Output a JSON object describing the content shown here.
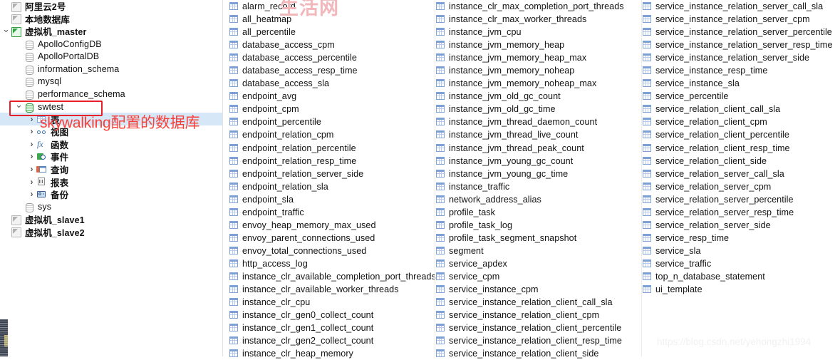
{
  "tree": {
    "items": [
      {
        "label": "阿里云2号",
        "icon": "connection-icon",
        "indent": 0,
        "twisty": "none",
        "state": "offline",
        "type": "connection"
      },
      {
        "label": "本地数据库",
        "icon": "connection-icon",
        "indent": 0,
        "twisty": "none",
        "state": "offline",
        "type": "connection"
      },
      {
        "label": "虚拟机_master",
        "icon": "connection-icon",
        "indent": 0,
        "twisty": "open",
        "state": "online",
        "type": "connection"
      },
      {
        "label": "ApolloConfigDB",
        "icon": "database-icon",
        "indent": 1,
        "twisty": "none",
        "state": "closed",
        "type": "database"
      },
      {
        "label": "ApolloPortalDB",
        "icon": "database-icon",
        "indent": 1,
        "twisty": "none",
        "state": "closed",
        "type": "database"
      },
      {
        "label": "information_schema",
        "icon": "database-icon",
        "indent": 1,
        "twisty": "none",
        "state": "closed",
        "type": "database"
      },
      {
        "label": "mysql",
        "icon": "database-icon",
        "indent": 1,
        "twisty": "none",
        "state": "closed",
        "type": "database"
      },
      {
        "label": "performance_schema",
        "icon": "database-icon",
        "indent": 1,
        "twisty": "none",
        "state": "closed",
        "type": "database"
      },
      {
        "label": "swtest",
        "icon": "database-icon",
        "indent": 1,
        "twisty": "open",
        "state": "open",
        "type": "database"
      },
      {
        "label": "表",
        "icon": "tables-folder-icon",
        "indent": 2,
        "twisty": "closed",
        "state": "selected",
        "type": "tables"
      },
      {
        "label": "视图",
        "icon": "views-icon",
        "indent": 2,
        "twisty": "closed",
        "state": "",
        "type": "views"
      },
      {
        "label": "函数",
        "icon": "functions-icon",
        "indent": 2,
        "twisty": "closed",
        "state": "",
        "type": "functions"
      },
      {
        "label": "事件",
        "icon": "events-icon",
        "indent": 2,
        "twisty": "closed",
        "state": "",
        "type": "events"
      },
      {
        "label": "查询",
        "icon": "query-icon",
        "indent": 2,
        "twisty": "closed",
        "state": "",
        "type": "query"
      },
      {
        "label": "报表",
        "icon": "report-icon",
        "indent": 2,
        "twisty": "closed",
        "state": "",
        "type": "report"
      },
      {
        "label": "备份",
        "icon": "backup-icon",
        "indent": 2,
        "twisty": "closed",
        "state": "",
        "type": "backup"
      },
      {
        "label": "sys",
        "icon": "database-icon",
        "indent": 1,
        "twisty": "none",
        "state": "closed",
        "type": "database"
      },
      {
        "label": "虚拟机_slave1",
        "icon": "connection-icon",
        "indent": 0,
        "twisty": "none",
        "state": "offline",
        "type": "connection"
      },
      {
        "label": "虚拟机_slave2",
        "icon": "connection-icon",
        "indent": 0,
        "twisty": "none",
        "state": "offline",
        "type": "connection"
      }
    ]
  },
  "annotation": {
    "note_text": "skywalking配置的数据库",
    "note_color": "#f8403a",
    "box_color": "#e8202a",
    "target_label": "swtest"
  },
  "selection": {
    "selected_label": "表",
    "highlight_color": "#d6e8f7"
  },
  "watermarks": {
    "top": "生活网",
    "bottom": "https://blog.csdn.net/yehongzhi1994"
  },
  "tables": {
    "icon": "table-grid-icon",
    "columns": [
      [
        "alarm_record",
        "all_heatmap",
        "all_percentile",
        "database_access_cpm",
        "database_access_percentile",
        "database_access_resp_time",
        "database_access_sla",
        "endpoint_avg",
        "endpoint_cpm",
        "endpoint_percentile",
        "endpoint_relation_cpm",
        "endpoint_relation_percentile",
        "endpoint_relation_resp_time",
        "endpoint_relation_server_side",
        "endpoint_relation_sla",
        "endpoint_sla",
        "endpoint_traffic",
        "envoy_heap_memory_max_used",
        "envoy_parent_connections_used",
        "envoy_total_connections_used",
        "http_access_log",
        "instance_clr_available_completion_port_threads",
        "instance_clr_available_worker_threads",
        "instance_clr_cpu",
        "instance_clr_gen0_collect_count",
        "instance_clr_gen1_collect_count",
        "instance_clr_gen2_collect_count",
        "instance_clr_heap_memory"
      ],
      [
        "instance_clr_max_completion_port_threads",
        "instance_clr_max_worker_threads",
        "instance_jvm_cpu",
        "instance_jvm_memory_heap",
        "instance_jvm_memory_heap_max",
        "instance_jvm_memory_noheap",
        "instance_jvm_memory_noheap_max",
        "instance_jvm_old_gc_count",
        "instance_jvm_old_gc_time",
        "instance_jvm_thread_daemon_count",
        "instance_jvm_thread_live_count",
        "instance_jvm_thread_peak_count",
        "instance_jvm_young_gc_count",
        "instance_jvm_young_gc_time",
        "instance_traffic",
        "network_address_alias",
        "profile_task",
        "profile_task_log",
        "profile_task_segment_snapshot",
        "segment",
        "service_apdex",
        "service_cpm",
        "service_instance_cpm",
        "service_instance_relation_client_call_sla",
        "service_instance_relation_client_cpm",
        "service_instance_relation_client_percentile",
        "service_instance_relation_client_resp_time",
        "service_instance_relation_client_side"
      ],
      [
        "service_instance_relation_server_call_sla",
        "service_instance_relation_server_cpm",
        "service_instance_relation_server_percentile",
        "service_instance_relation_server_resp_time",
        "service_instance_relation_server_side",
        "service_instance_resp_time",
        "service_instance_sla",
        "service_percentile",
        "service_relation_client_call_sla",
        "service_relation_client_cpm",
        "service_relation_client_percentile",
        "service_relation_client_resp_time",
        "service_relation_client_side",
        "service_relation_server_call_sla",
        "service_relation_server_cpm",
        "service_relation_server_percentile",
        "service_relation_server_resp_time",
        "service_relation_server_side",
        "service_resp_time",
        "service_sla",
        "service_traffic",
        "top_n_database_statement",
        "ui_template"
      ]
    ]
  }
}
